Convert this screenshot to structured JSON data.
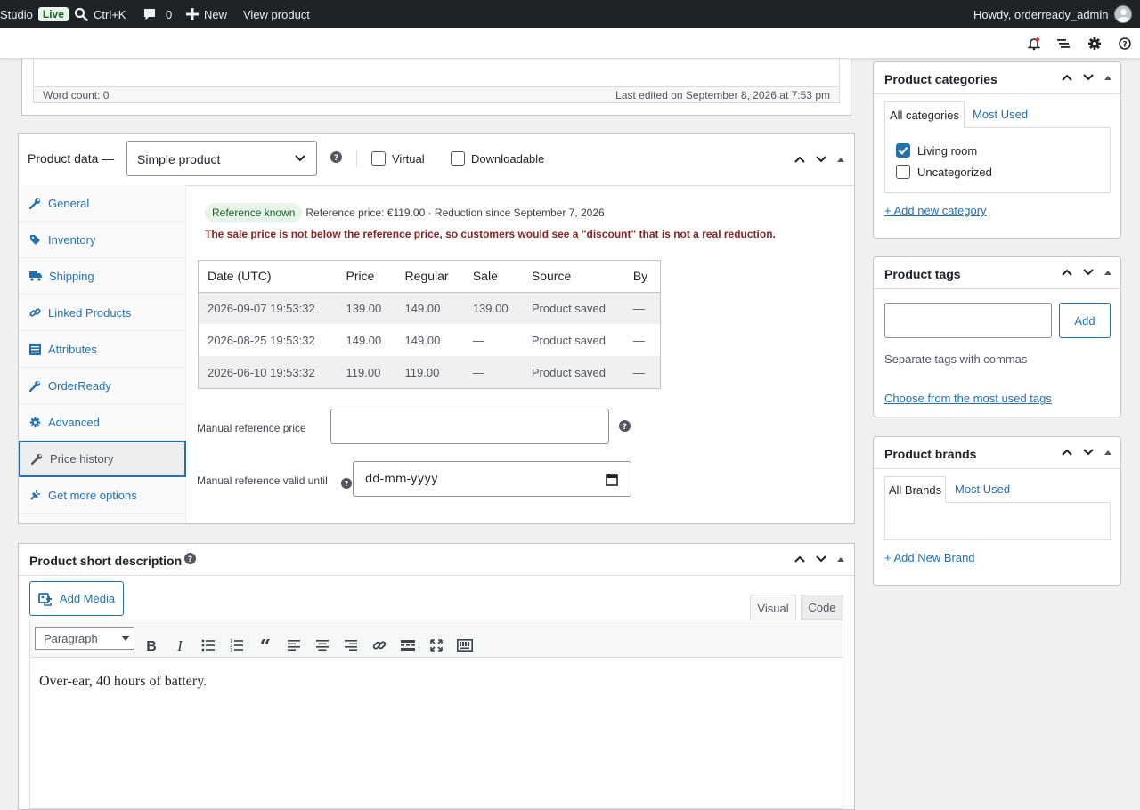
{
  "adminbar": {
    "site": "Studio",
    "live_badge": "Live",
    "search_shortcut": "Ctrl+K",
    "comments_count": "0",
    "new_label": "New",
    "view_product": "View product",
    "howdy": "Howdy, orderready_admin"
  },
  "editor": {
    "word_count": "Word count: 0",
    "last_edited": "Last edited on September 8, 2026 at 7:53 pm"
  },
  "product_data": {
    "title": "Product data —",
    "product_type": "Simple product",
    "virtual_label": "Virtual",
    "downloadable_label": "Downloadable",
    "tabs": [
      {
        "label": "General",
        "icon": "wrench-icon"
      },
      {
        "label": "Inventory",
        "icon": "tag-icon"
      },
      {
        "label": "Shipping",
        "icon": "truck-icon"
      },
      {
        "label": "Linked Products",
        "icon": "link-icon"
      },
      {
        "label": "Attributes",
        "icon": "list-icon"
      },
      {
        "label": "OrderReady",
        "icon": "wrench-icon"
      },
      {
        "label": "Advanced",
        "icon": "gear-icon"
      },
      {
        "label": "Price history",
        "icon": "wrench-icon"
      },
      {
        "label": "Get more options",
        "icon": "plugin-icon"
      }
    ],
    "active_tab": "Price history",
    "reference_badge": "Reference known",
    "reference_info": "Reference price: €119.00 · Reduction since September 7, 2026",
    "warning": "The sale price is not below the reference price, so customers would see a \"discount\" that is not a real reduction.",
    "history_columns": [
      "Date (UTC)",
      "Price",
      "Regular",
      "Sale",
      "Source",
      "By"
    ],
    "history_rows": [
      [
        "2026-09-07 19:53:32",
        "139.00",
        "149.00",
        "139.00",
        "Product saved",
        "—"
      ],
      [
        "2026-08-25 19:53:32",
        "149.00",
        "149.00",
        "—",
        "Product saved",
        "—"
      ],
      [
        "2026-06-10 19:53:32",
        "119.00",
        "119.00",
        "—",
        "Product saved",
        "—"
      ]
    ],
    "manual_price_label": "Manual reference price",
    "manual_price_value": "",
    "manual_valid_label": "Manual reference valid until",
    "manual_valid_placeholder": "dd-mm-yyyy"
  },
  "short_description": {
    "title": "Product short description",
    "add_media": "Add Media",
    "tab_visual": "Visual",
    "tab_code": "Code",
    "format": "Paragraph",
    "content": "Over-ear, 40 hours of battery."
  },
  "categories": {
    "title": "Product categories",
    "tab_all": "All categories",
    "tab_most_used": "Most Used",
    "items": [
      {
        "label": "Living room",
        "checked": true
      },
      {
        "label": "Uncategorized",
        "checked": false
      }
    ],
    "add_new": "+ Add new category"
  },
  "tags": {
    "title": "Product tags",
    "input_value": "",
    "add_button": "Add",
    "hint": "Separate tags with commas",
    "choose_link": "Choose from the most used tags"
  },
  "brands": {
    "title": "Product brands",
    "tab_all": "All Brands",
    "tab_most_used": "Most Used",
    "add_new": "+ Add New Brand"
  },
  "colors": {
    "accent": "#2271b1",
    "adminbar": "#1d2327",
    "warning": "#8a2424",
    "badge_bg": "#e6f4ea"
  }
}
